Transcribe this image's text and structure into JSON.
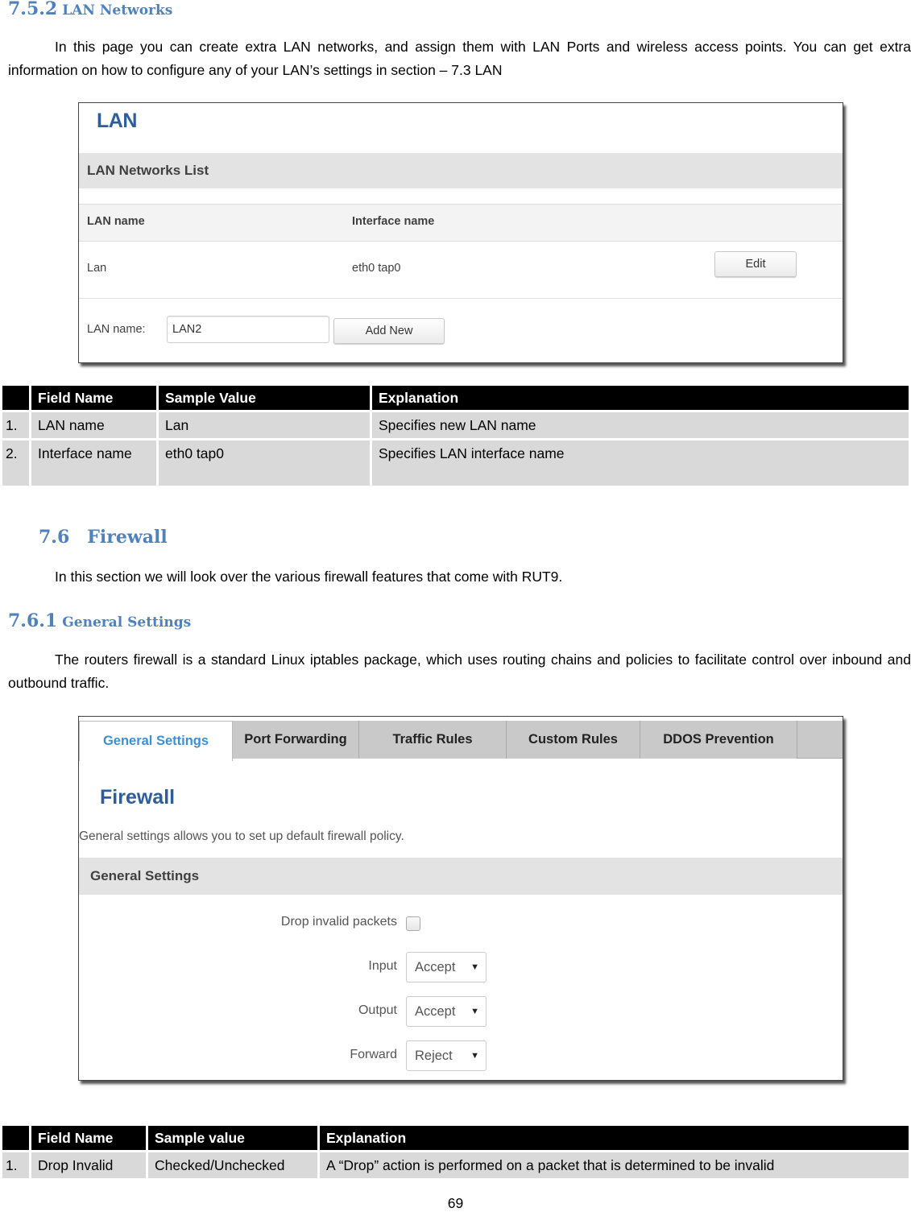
{
  "sections": {
    "lan_networks": {
      "number": "7.5.2",
      "title": "LAN Networks",
      "paragraph": "In this page you can create extra LAN networks, and assign them with LAN Ports and wireless access points. You can get extra information on how to configure any of your LAN’s settings in section – 7.3 LAN"
    },
    "firewall": {
      "number": "7.6",
      "title": "Firewall",
      "paragraph": "In this section we will look over the various firewall features that come with RUT9."
    },
    "general_settings": {
      "number": "7.6.1",
      "title": "General Settings",
      "paragraph": "The routers firewall is a standard Linux iptables package, which uses routing chains and policies to facilitate control over inbound and outbound traffic."
    }
  },
  "lan_screenshot": {
    "title": "LAN",
    "section_title": "LAN Networks List",
    "columns": [
      "LAN name",
      "Interface name"
    ],
    "rows": [
      {
        "lan_name": "Lan",
        "interface_name": "eth0 tap0",
        "action": "Edit"
      }
    ],
    "add_form": {
      "label": "LAN name:",
      "input_value": "LAN2",
      "button": "Add New"
    }
  },
  "lan_table": {
    "headers": [
      "",
      "Field Name",
      "Sample Value",
      "Explanation"
    ],
    "rows": [
      {
        "num": "1.",
        "field": "LAN name",
        "sample": "Lan",
        "explanation": "Specifies new LAN name"
      },
      {
        "num": "2.",
        "field": "Interface name",
        "sample": "eth0 tap0",
        "explanation": "Specifies LAN interface name"
      }
    ]
  },
  "firewall_screenshot": {
    "tabs": [
      {
        "label": "General Settings",
        "active": true
      },
      {
        "label": "Port Forwarding",
        "active": false
      },
      {
        "label": "Traffic Rules",
        "active": false
      },
      {
        "label": "Custom Rules",
        "active": false
      },
      {
        "label": "DDOS Prevention",
        "active": false
      }
    ],
    "title": "Firewall",
    "description": "General settings allows you to set up default firewall policy.",
    "section_title": "General Settings",
    "fields": {
      "drop_invalid": {
        "label": "Drop invalid packets",
        "checked": false
      },
      "input": {
        "label": "Input",
        "value": "Accept"
      },
      "output": {
        "label": "Output",
        "value": "Accept"
      },
      "forward": {
        "label": "Forward",
        "value": "Reject"
      }
    }
  },
  "firewall_table": {
    "headers": [
      "",
      "Field Name",
      "Sample value",
      "Explanation"
    ],
    "rows": [
      {
        "num": "1.",
        "field": "Drop Invalid",
        "sample": "Checked/Unchecked",
        "explanation": "A “Drop” action is performed on a packet that is determined to be invalid"
      }
    ]
  },
  "page_number": "69",
  "colors": {
    "heading": "#4f81bd",
    "ui_title": "#2d5e9a",
    "active_tab": "#3d8fd6",
    "table_header_bg": "#000000",
    "table_cell_bg": "#d9d9d9"
  }
}
